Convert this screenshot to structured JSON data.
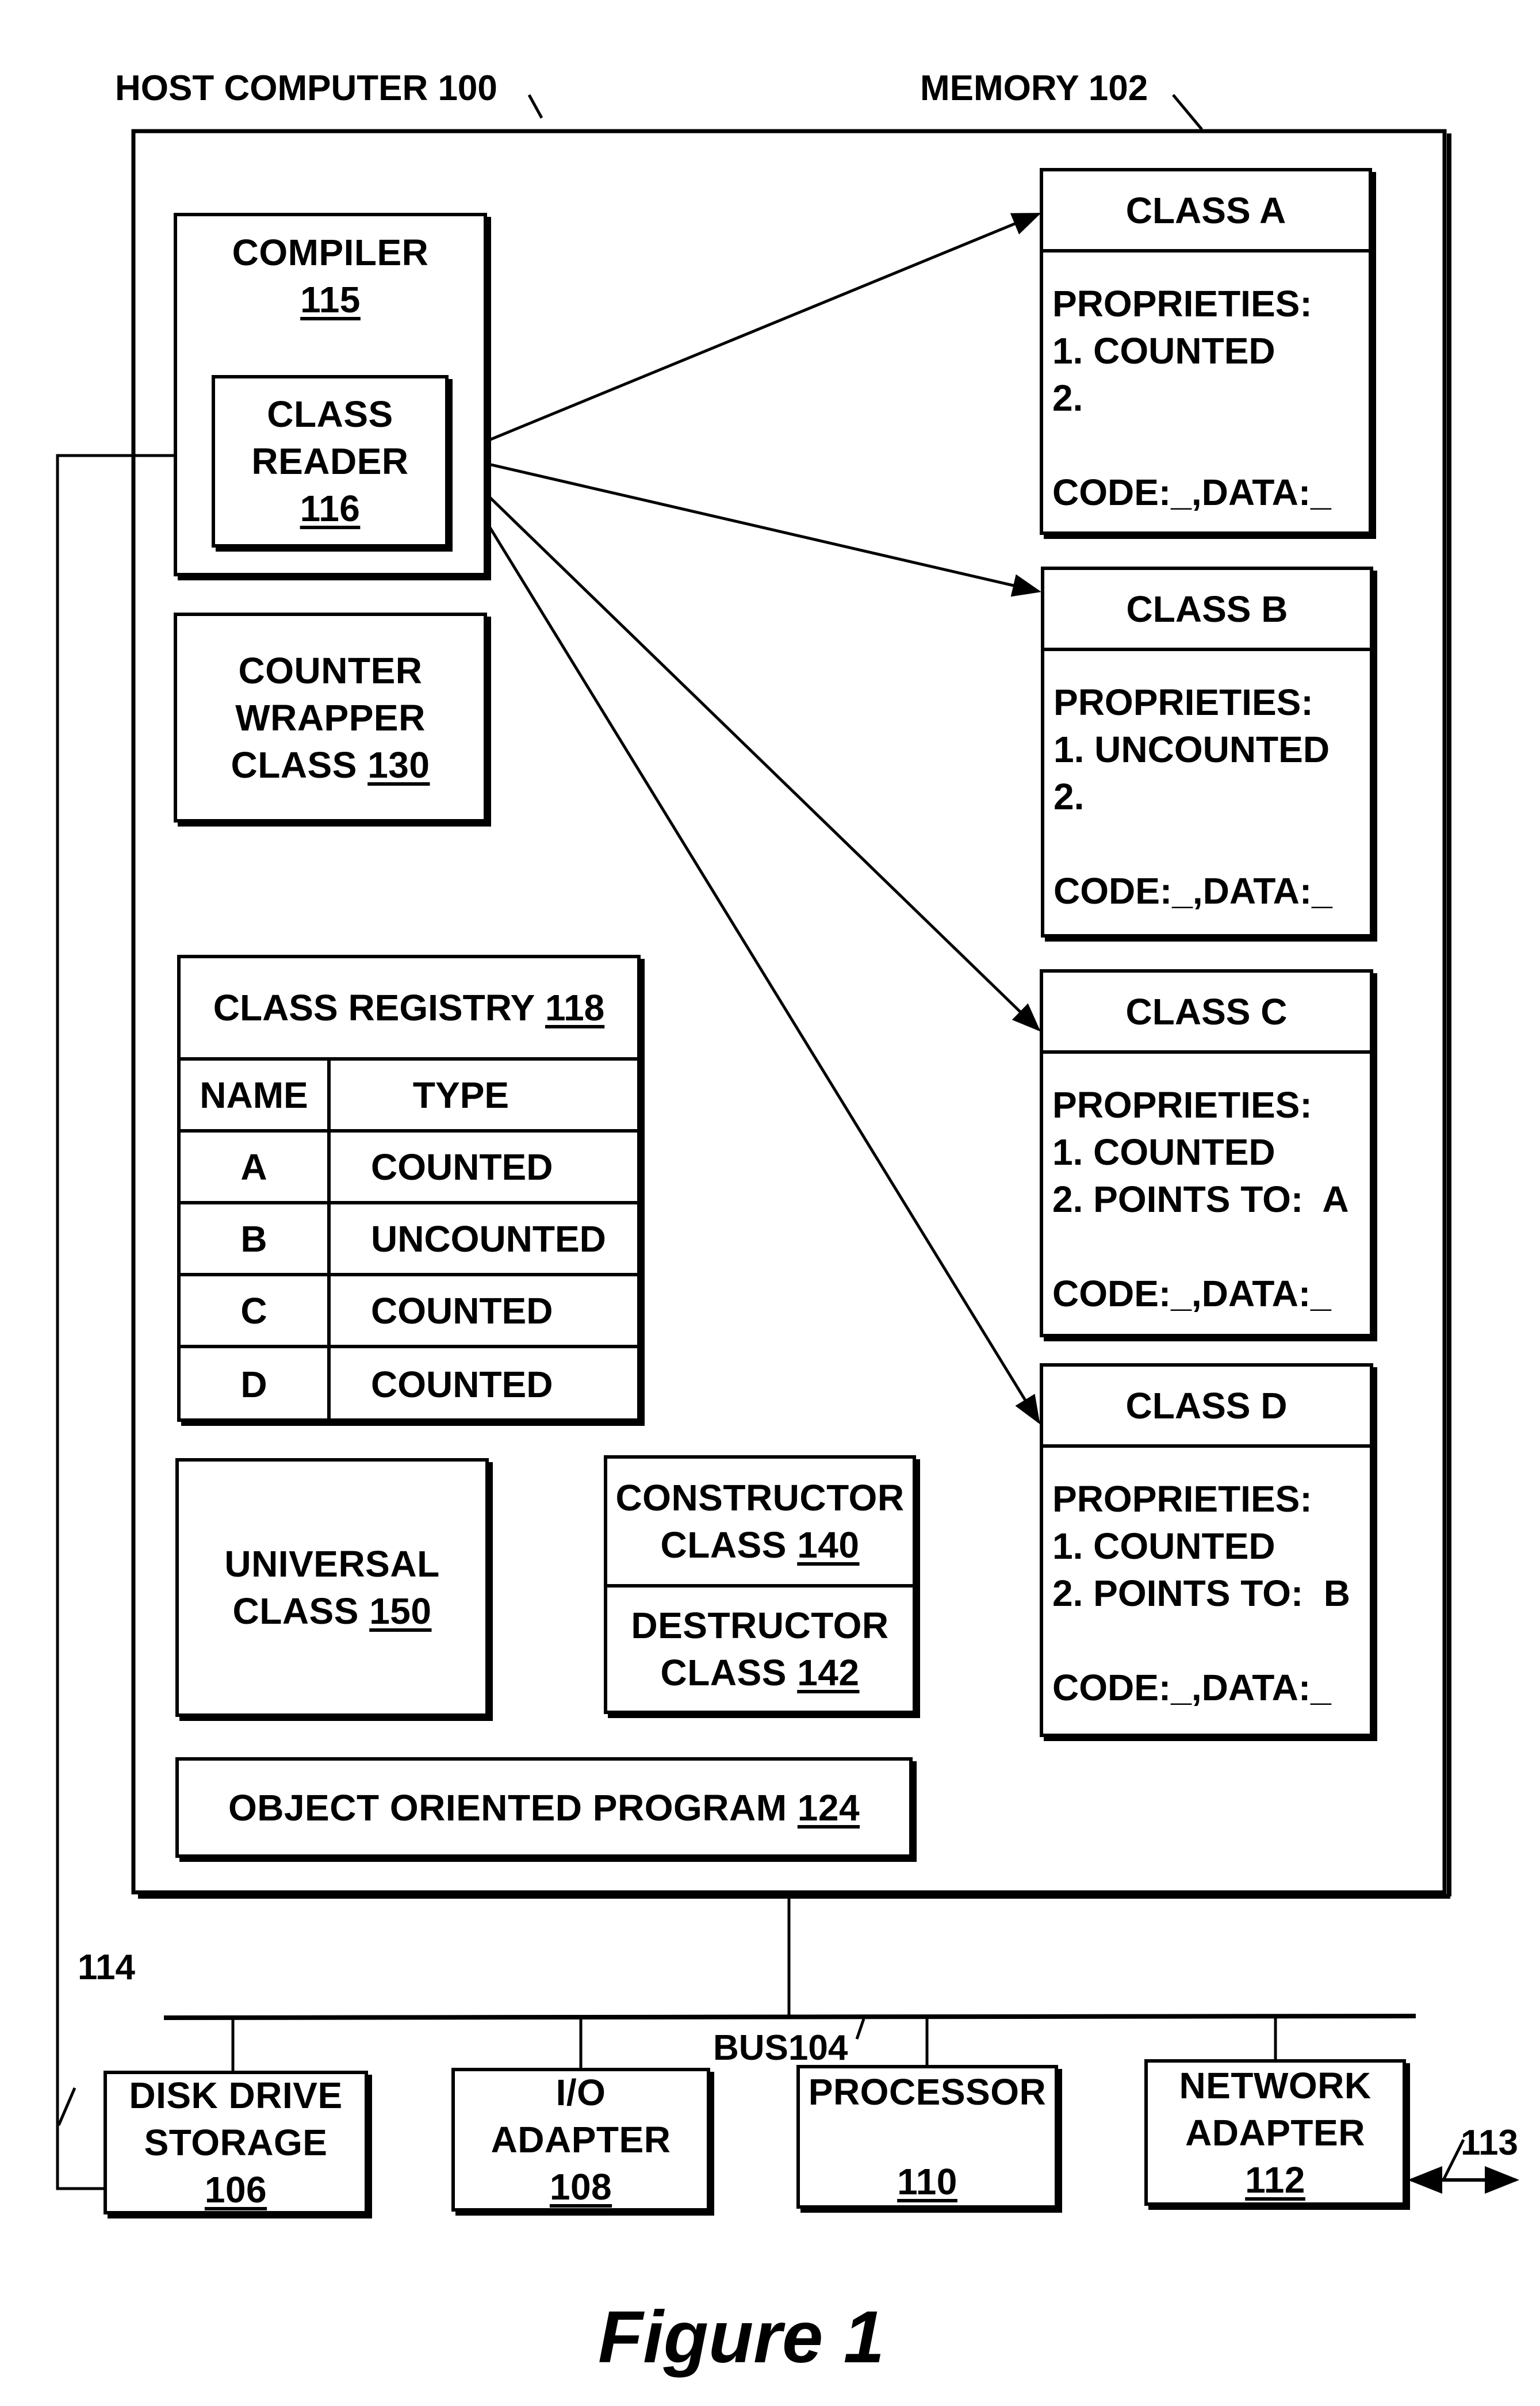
{
  "labels": {
    "host_computer": "HOST COMPUTER 100",
    "memory": "MEMORY 102",
    "bus": "BUS104",
    "line_114": "114",
    "line_113": "113",
    "figure_caption": "Figure 1"
  },
  "compiler": {
    "title": "COMPILER",
    "ref": "115"
  },
  "class_reader": {
    "line1": "CLASS",
    "line2": "READER",
    "ref": "116"
  },
  "counter_wrapper": {
    "line1": "COUNTER",
    "line2": "WRAPPER",
    "line3": "CLASS",
    "ref": "130"
  },
  "class_registry": {
    "title": "CLASS REGISTRY",
    "ref": "118",
    "columns": [
      "NAME",
      "TYPE"
    ],
    "rows": [
      {
        "name": "A",
        "type": "COUNTED"
      },
      {
        "name": "B",
        "type": "UNCOUNTED"
      },
      {
        "name": "C",
        "type": "COUNTED"
      },
      {
        "name": "D",
        "type": "COUNTED"
      }
    ]
  },
  "universal_class": {
    "line1": "UNIVERSAL",
    "line2": "CLASS",
    "ref": "150"
  },
  "constructor_class": {
    "line1": "CONSTRUCTOR",
    "line2": "CLASS",
    "ref": "140"
  },
  "destructor_class": {
    "line1": "DESTRUCTOR",
    "line2": "CLASS",
    "ref": "142"
  },
  "oop": {
    "text": "OBJECT ORIENTED PROGRAM",
    "ref": "124"
  },
  "classes": [
    {
      "title": "CLASS A",
      "props_label": "PROPRIETIES:",
      "prop1": "1. COUNTED",
      "prop2": "2.",
      "code": "CODE:_,DATA:_"
    },
    {
      "title": "CLASS B",
      "props_label": "PROPRIETIES:",
      "prop1": "1. UNCOUNTED",
      "prop2": "2.",
      "code": "CODE:_,DATA:_"
    },
    {
      "title": "CLASS C",
      "props_label": "PROPRIETIES:",
      "prop1": "1. COUNTED",
      "prop2": "2. POINTS TO:  A",
      "code": "CODE:_,DATA:_"
    },
    {
      "title": "CLASS D",
      "props_label": "PROPRIETIES:",
      "prop1": "1. COUNTED",
      "prop2": "2. POINTS TO:  B",
      "code": "CODE:_,DATA:_"
    }
  ],
  "devices": [
    {
      "line1": "DISK DRIVE",
      "line2": "STORAGE",
      "ref": "106"
    },
    {
      "line1": "I/O",
      "line2": "ADAPTER",
      "ref": "108"
    },
    {
      "line1": "PROCESSOR",
      "line2": "",
      "ref": "110"
    },
    {
      "line1": "NETWORK",
      "line2": "ADAPTER",
      "ref": "112"
    }
  ]
}
